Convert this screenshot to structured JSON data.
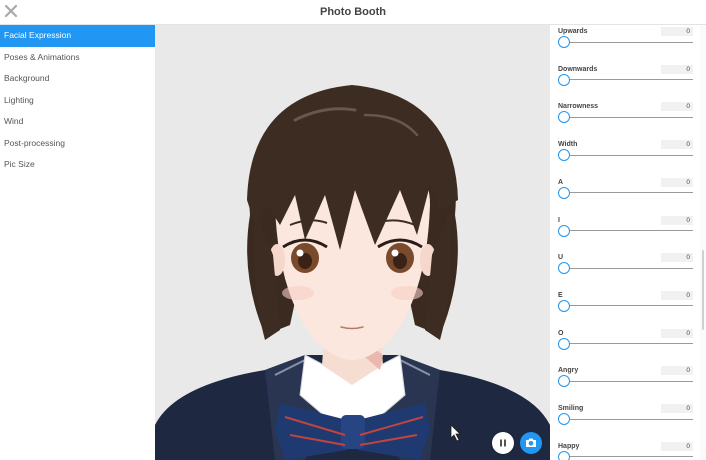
{
  "window": {
    "title": "Photo Booth",
    "close_icon": "close-icon"
  },
  "sidebar": {
    "items": [
      {
        "label": "Facial Expression",
        "active": true
      },
      {
        "label": "Poses & Animations",
        "active": false
      },
      {
        "label": "Background",
        "active": false
      },
      {
        "label": "Lighting",
        "active": false
      },
      {
        "label": "Wind",
        "active": false
      },
      {
        "label": "Post-processing",
        "active": false
      },
      {
        "label": "Pic Size",
        "active": false
      }
    ]
  },
  "viewport": {
    "subject": "anime-character-avatar",
    "pause_icon": "pause-icon",
    "camera_icon": "camera-icon"
  },
  "panel": {
    "sliders": [
      {
        "label": "Upwards",
        "value": "0",
        "level": 0
      },
      {
        "label": "Downwards",
        "value": "0",
        "level": 0
      },
      {
        "label": "Narrowness",
        "value": "0",
        "level": 0
      },
      {
        "label": "Width",
        "value": "0",
        "level": 0
      },
      {
        "label": "A",
        "value": "0",
        "level": 0
      },
      {
        "label": "I",
        "value": "0",
        "level": 0
      },
      {
        "label": "U",
        "value": "0",
        "level": 0
      },
      {
        "label": "E",
        "value": "0",
        "level": 0
      },
      {
        "label": "O",
        "value": "0",
        "level": 0
      },
      {
        "label": "Angry",
        "value": "0",
        "level": 0
      },
      {
        "label": "Smiling",
        "value": "0",
        "level": 0
      },
      {
        "label": "Happy",
        "value": "0",
        "level": 0
      }
    ]
  },
  "colors": {
    "accent": "#2196f3",
    "viewport_bg": "#e9e9e9",
    "hair": "#3a2a20",
    "jacket": "#1e2840"
  }
}
